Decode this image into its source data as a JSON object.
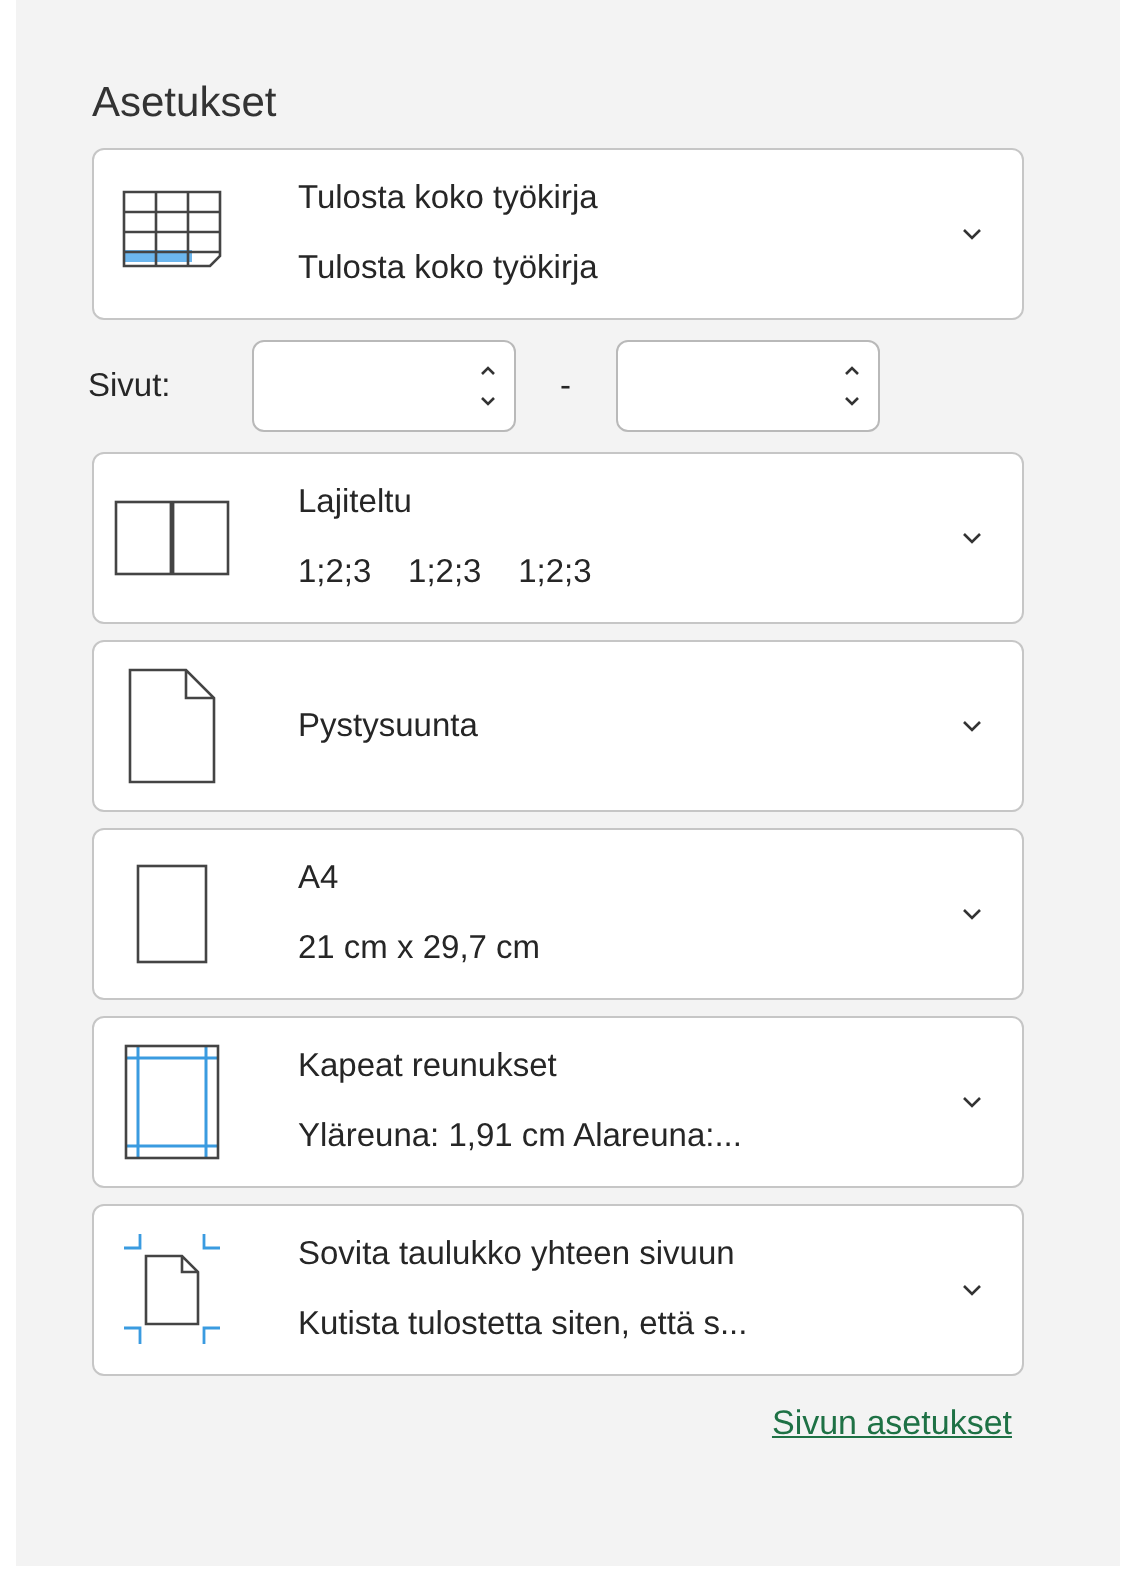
{
  "section": {
    "title": "Asetukset"
  },
  "settings": [
    {
      "line1": "Tulosta koko työkirja",
      "line2": "Tulosta koko työkirja"
    },
    {
      "line1": "Lajiteltu",
      "line2": "1;2;3    1;2;3    1;2;3"
    },
    {
      "line1": "Pystysuunta"
    },
    {
      "line1": "A4",
      "line2": "21 cm x 29,7 cm"
    },
    {
      "line1": "Kapeat reunukset",
      "line2": "Yläreuna: 1,91 cm Alareuna:..."
    },
    {
      "line1": "Sovita taulukko yhteen sivuun",
      "line2": "Kutista tulostetta siten, että s..."
    }
  ],
  "pages": {
    "label": "Sivut:",
    "separator": "-"
  },
  "link": "Sivun asetukset"
}
